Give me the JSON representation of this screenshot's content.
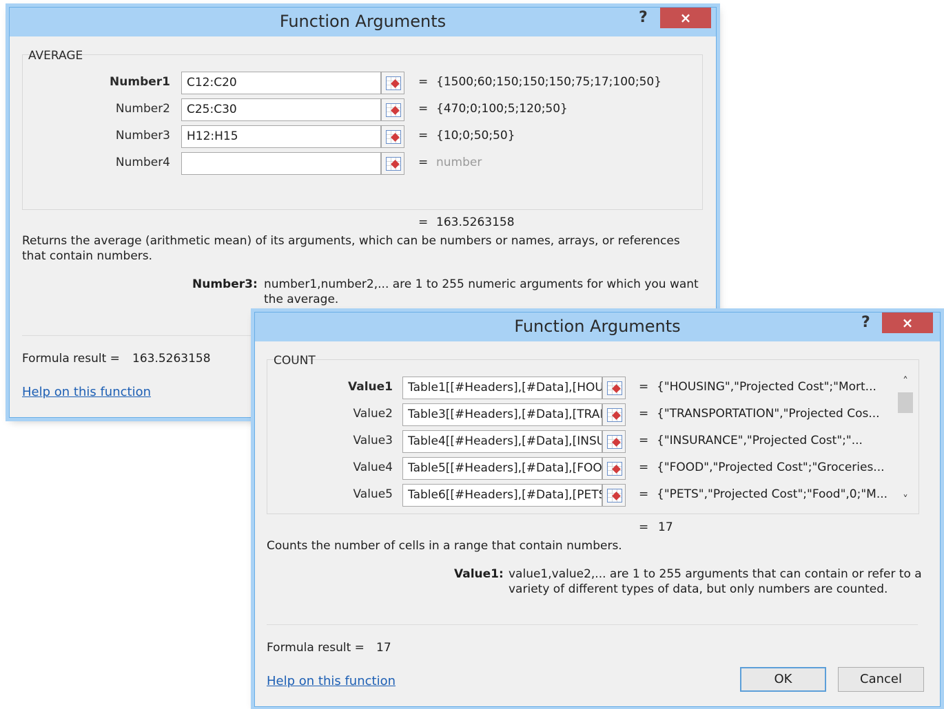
{
  "dialog1": {
    "title": "Function Arguments",
    "help": "?",
    "close": "×",
    "function_name": "AVERAGE",
    "args": [
      {
        "label": "Number1",
        "value": "C12:C20",
        "result": "{1500;60;150;150;150;75;17;100;50}"
      },
      {
        "label": "Number2",
        "value": "C25:C30",
        "result": "{470;0;100;5;120;50}"
      },
      {
        "label": "Number3",
        "value": "H12:H15",
        "result": "{10;0;50;50}"
      },
      {
        "label": "Number4",
        "value": "",
        "result": "number"
      }
    ],
    "equals": "=",
    "total_result": "163.5263158",
    "description": "Returns the average (arithmetic mean) of its arguments, which can be numbers or names, arrays, or references that contain numbers.",
    "arg_help_label": "Number3:",
    "arg_help_text": "number1,number2,... are 1 to 255 numeric arguments for which you want the average.",
    "formula_result_label": "Formula result =",
    "formula_result_value": "163.5263158",
    "help_link": "Help on this function"
  },
  "dialog2": {
    "title": "Function Arguments",
    "help": "?",
    "close": "×",
    "function_name": "COUNT",
    "args": [
      {
        "label": "Value1",
        "value": "Table1[[#Headers],[#Data],[HOU",
        "result": "{\"HOUSING\",\"Projected Cost\";\"Mort..."
      },
      {
        "label": "Value2",
        "value": "Table3[[#Headers],[#Data],[TRAN",
        "result": "{\"TRANSPORTATION\",\"Projected Cos..."
      },
      {
        "label": "Value3",
        "value": "Table4[[#Headers],[#Data],[INSU",
        "result": "{\"INSURANCE\",\"Projected Cost\";\"..."
      },
      {
        "label": "Value4",
        "value": "Table5[[#Headers],[#Data],[FOO",
        "result": "{\"FOOD\",\"Projected Cost\";\"Groceries..."
      },
      {
        "label": "Value5",
        "value": "Table6[[#Headers],[#Data],[PETS",
        "result": "{\"PETS\",\"Projected Cost\";\"Food\",0;\"M..."
      }
    ],
    "equals": "=",
    "total_result": "17",
    "description": "Counts the number of cells in a range that contain numbers.",
    "arg_help_label": "Value1:",
    "arg_help_text": "value1,value2,... are 1 to 255 arguments that can contain or refer to a variety of different types of data, but only numbers are counted.",
    "formula_result_label": "Formula result =",
    "formula_result_value": "17",
    "help_link": "Help on this function",
    "ok_label": "OK",
    "cancel_label": "Cancel",
    "scroll_up": "˄",
    "scroll_down": "˅"
  }
}
